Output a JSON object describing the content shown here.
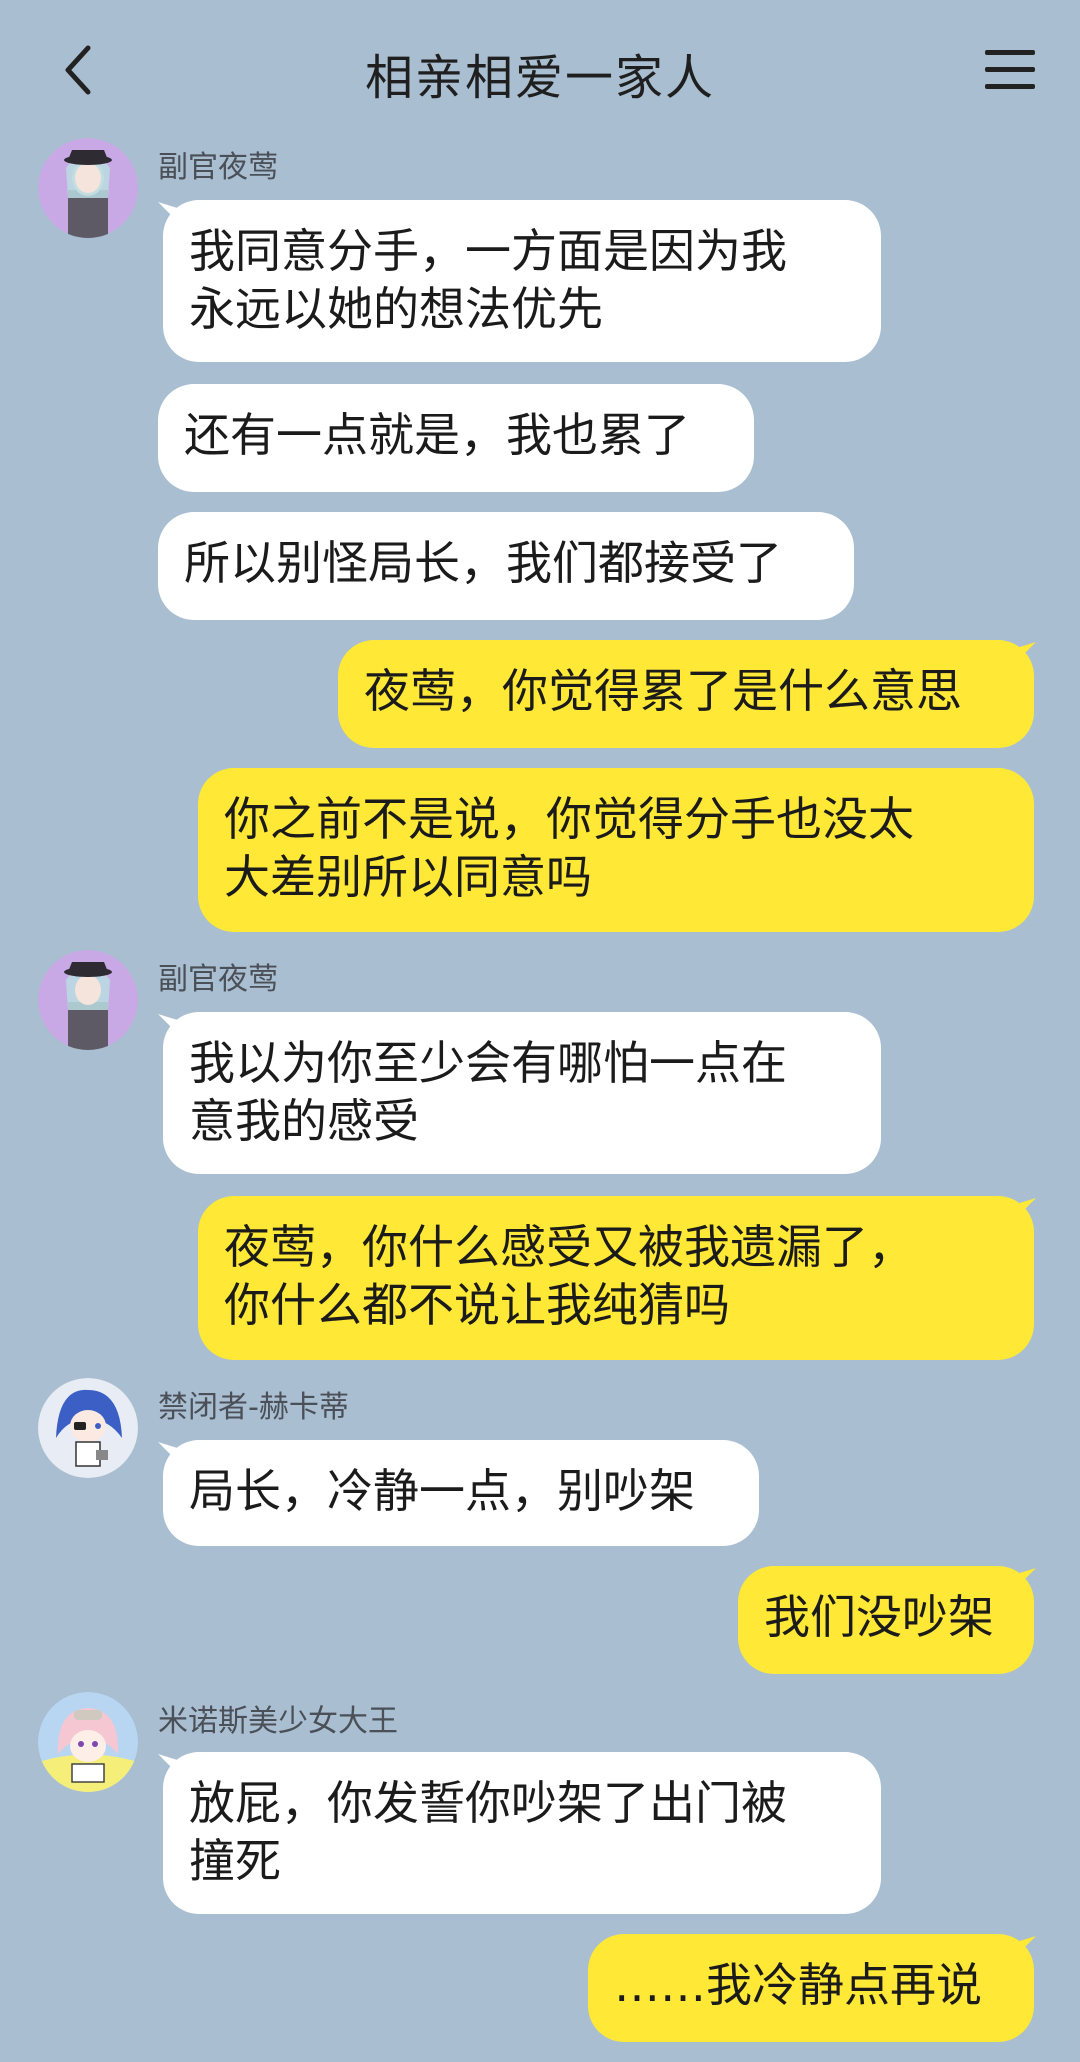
{
  "header": {
    "title": "相亲相爱一家人",
    "back_icon": "chevron-left-icon",
    "menu_icon": "menu-icon"
  },
  "colors": {
    "background": "#a9bed0",
    "bubble_left": "#ffffff",
    "bubble_right": "#ffe836"
  },
  "messages": [
    {
      "side": "left",
      "sender": "副官夜莺",
      "text": "我同意分手，一方面是因为我\n永远以她的想法优先"
    },
    {
      "side": "left",
      "text": "还有一点就是，我也累了"
    },
    {
      "side": "left",
      "text": "所以别怪局长，我们都接受了"
    },
    {
      "side": "right",
      "text": "夜莺，你觉得累了是什么意思"
    },
    {
      "side": "right",
      "text": "你之前不是说，你觉得分手也没太\n大差别所以同意吗"
    },
    {
      "side": "left",
      "sender": "副官夜莺",
      "text": "我以为你至少会有哪怕一点在\n意我的感受"
    },
    {
      "side": "right",
      "text": "夜莺，你什么感受又被我遗漏了，\n你什么都不说让我纯猜吗"
    },
    {
      "side": "left",
      "sender": "禁闭者-赫卡蒂",
      "text": "局长，冷静一点，别吵架"
    },
    {
      "side": "right",
      "text": "我们没吵架"
    },
    {
      "side": "left",
      "sender": "米诺斯美少女大王",
      "text": "放屁，你发誓你吵架了出门被\n撞死"
    },
    {
      "side": "right",
      "text": "……我冷静点再说"
    }
  ]
}
